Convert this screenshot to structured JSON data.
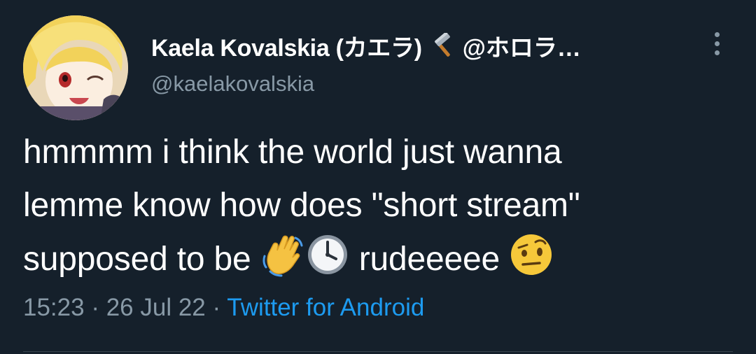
{
  "tweet": {
    "author": {
      "display_name": "Kaela Kovalskia (カエラ)",
      "name_icon": "hammer-icon",
      "name_tail": "@ホロラ…",
      "handle": "@kaelakovalskia",
      "avatar": "avatar-image"
    },
    "text": {
      "line1": "hmmmm i think the world just wanna",
      "line2": "lemme know how does \"short stream\"",
      "line3_a": "supposed to be",
      "line3_emojis": [
        "waving-hand-icon",
        "clock-icon"
      ],
      "line3_b": "rudeeeee",
      "line3_end_emoji": "raised-eyebrow-face-icon"
    },
    "meta": {
      "time": "15:23",
      "separator": " · ",
      "date": "26 Jul 22",
      "source": "Twitter for Android"
    },
    "more_menu": "more-options-icon"
  },
  "colors": {
    "background": "#15202b",
    "text": "#ffffff",
    "secondary": "#8899a6",
    "link": "#1d9bf0",
    "divider": "#38444d"
  }
}
